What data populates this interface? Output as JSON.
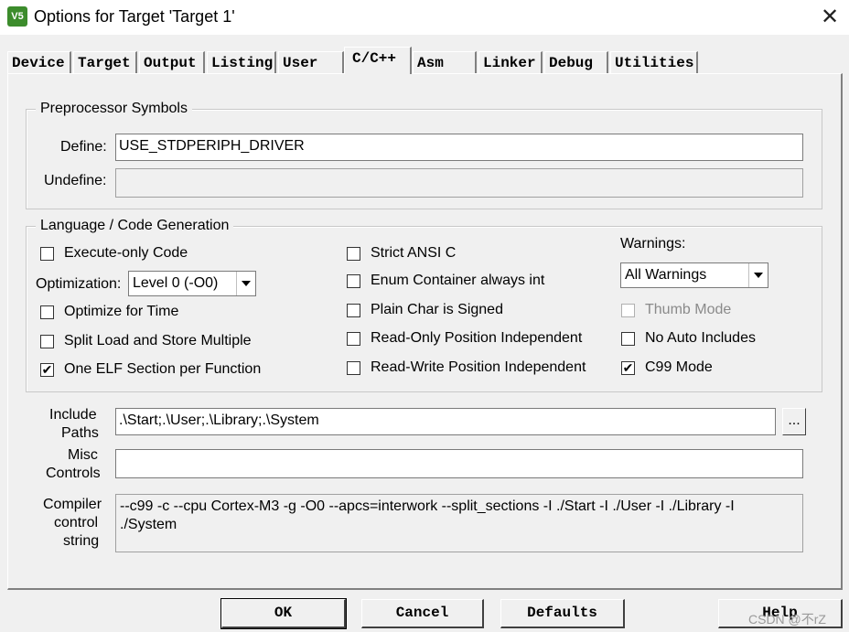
{
  "window": {
    "title": "Options for Target 'Target 1'",
    "icon_text": "V5",
    "close_glyph": "✕"
  },
  "tabs": [
    {
      "label": "Device"
    },
    {
      "label": "Target"
    },
    {
      "label": "Output"
    },
    {
      "label": "Listing"
    },
    {
      "label": "User"
    },
    {
      "label": "C/C++"
    },
    {
      "label": "Asm"
    },
    {
      "label": "Linker"
    },
    {
      "label": "Debug"
    },
    {
      "label": "Utilities"
    }
  ],
  "active_tab": "C/C++",
  "preprocessor": {
    "group_label": "Preprocessor Symbols",
    "define_label": "Define:",
    "define_value": "USE_STDPERIPH_DRIVER",
    "undefine_label": "Undefine:",
    "undefine_value": ""
  },
  "language": {
    "group_label": "Language / Code Generation",
    "execute_only": {
      "label": "Execute-only Code",
      "checked": false
    },
    "optimization_label": "Optimization:",
    "optimization_value": "Level 0 (-O0)",
    "optimize_time": {
      "label": "Optimize for Time",
      "checked": false
    },
    "split_load": {
      "label": "Split Load and Store Multiple",
      "checked": false
    },
    "one_elf": {
      "label": "One ELF Section per Function",
      "checked": true
    },
    "strict_ansi": {
      "label": "Strict ANSI C",
      "checked": false
    },
    "enum_container": {
      "label": "Enum Container always int",
      "checked": false
    },
    "plain_char": {
      "label": "Plain Char is Signed",
      "checked": false
    },
    "ro_pi": {
      "label": "Read-Only Position Independent",
      "checked": false
    },
    "rw_pi": {
      "label": "Read-Write Position Independent",
      "checked": false
    },
    "warnings_label": "Warnings:",
    "warnings_value": "All Warnings",
    "thumb_mode": {
      "label": "Thumb Mode",
      "checked": false,
      "disabled": true
    },
    "no_auto_includes": {
      "label": "No Auto Includes",
      "checked": false
    },
    "c99_mode": {
      "label": "C99 Mode",
      "checked": true
    }
  },
  "include": {
    "label_line1": "Include",
    "label_line2": "Paths",
    "value": ".\\Start;.\\User;.\\Library;.\\System",
    "browse_label": "..."
  },
  "misc": {
    "label_line1": "Misc",
    "label_line2": "Controls",
    "value": ""
  },
  "compiler": {
    "label_line1": "Compiler",
    "label_line2": "control",
    "label_line3": "string",
    "line1": "--c99 -c --cpu Cortex-M3 -g -O0 --apcs=interwork --split_sections -I ./Start -I ./User -I ./Library -I",
    "line2": "./System"
  },
  "buttons": {
    "ok": "OK",
    "cancel": "Cancel",
    "defaults": "Defaults",
    "help": "Help"
  },
  "watermark": "CSDN @不rZ",
  "check_glyph": "✔"
}
